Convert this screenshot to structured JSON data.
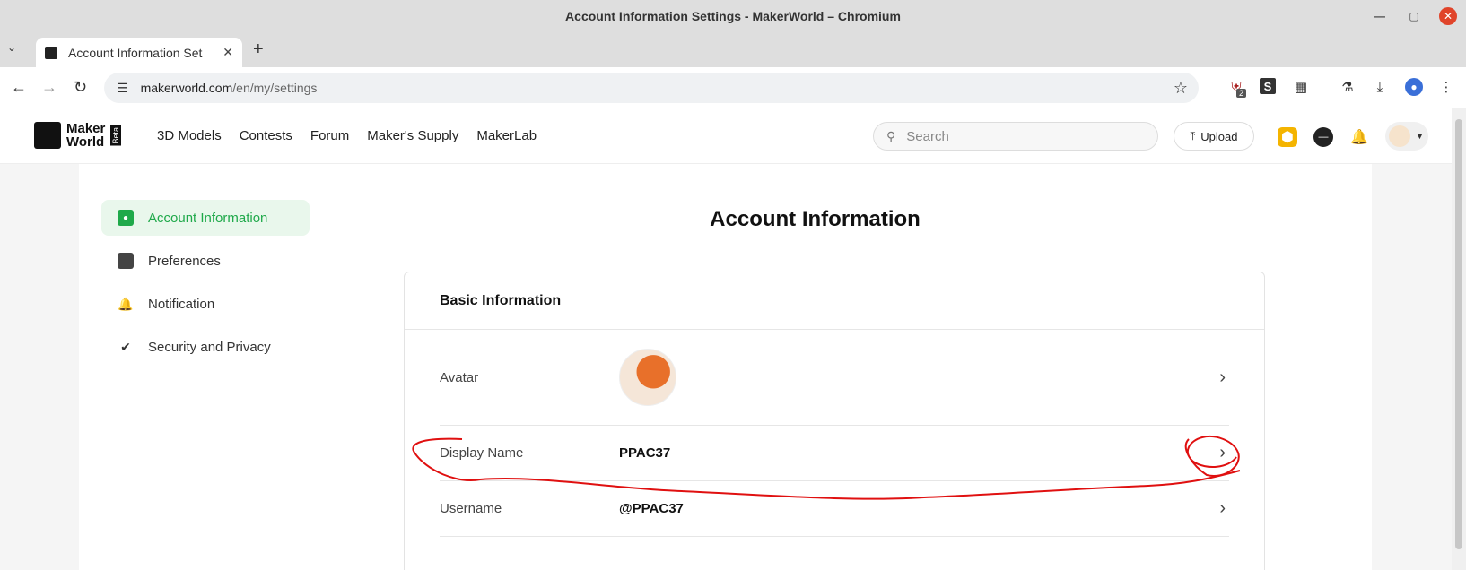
{
  "window": {
    "title": "Account Information Settings - MakerWorld – Chromium"
  },
  "tabs": [
    {
      "label": "Account Information Set",
      "close": "✕"
    }
  ],
  "newtab_label": "+",
  "address": {
    "host": "makerworld.com",
    "path": "/en/my/settings"
  },
  "extensions": {
    "shield_count": "2",
    "s_label": "S"
  },
  "site": {
    "logo_line1": "Maker",
    "logo_line2": "World",
    "logo_beta": "Beta",
    "nav": [
      "3D Models",
      "Contests",
      "Forum",
      "Maker's Supply",
      "MakerLab"
    ],
    "search_placeholder": "Search",
    "upload_label": "Upload"
  },
  "sidebar": {
    "items": [
      {
        "label": "Account Information",
        "icon": "account-card-icon",
        "active": true
      },
      {
        "label": "Preferences",
        "icon": "bookmark-icon",
        "active": false
      },
      {
        "label": "Notification",
        "icon": "bell-icon",
        "active": false
      },
      {
        "label": "Security and Privacy",
        "icon": "shield-check-icon",
        "active": false
      }
    ]
  },
  "main": {
    "title": "Account Information",
    "section_title": "Basic Information",
    "rows": [
      {
        "label": "Avatar",
        "value": ""
      },
      {
        "label": "Display Name",
        "value": "PPAC37"
      },
      {
        "label": "Username",
        "value": "@PPAC37"
      }
    ]
  },
  "colors": {
    "accent": "#1fa94a",
    "annotation": "#e01010"
  }
}
